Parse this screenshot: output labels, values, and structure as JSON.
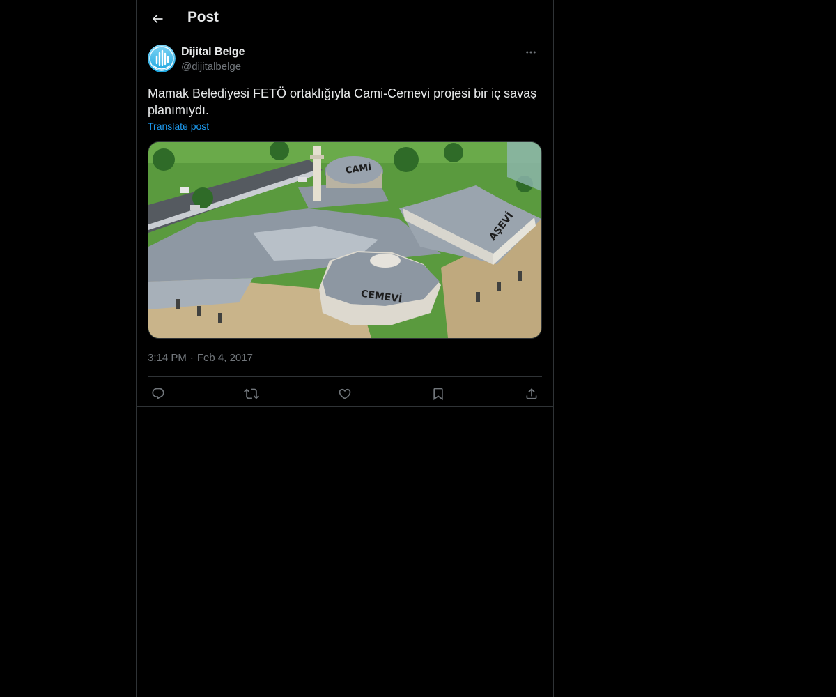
{
  "header": {
    "title": "Post",
    "back_icon": "arrow-left-icon"
  },
  "post": {
    "author": {
      "name": "Dijital Belge",
      "handle": "@dijitalbelge",
      "avatar_icon": "blue-circle-logo"
    },
    "text": "Mamak Belediyesi FETÖ ortaklığıyla Cami-Cemevi projesi bir iç savaş planımıydı.",
    "translate_label": "Translate post",
    "media": {
      "labels": [
        "CAMİ",
        "AŞEVİ",
        "CEMEVİ"
      ]
    },
    "time": "3:14 PM",
    "separator": "·",
    "date": "Feb 4, 2017"
  },
  "actions": [
    "reply-icon",
    "repost-icon",
    "like-icon",
    "bookmark-icon",
    "share-icon"
  ],
  "colors": {
    "background": "#000000",
    "text": "#e7e9ea",
    "secondary": "#71767b",
    "accent": "#1d9bf0",
    "border": "#2f3336"
  }
}
